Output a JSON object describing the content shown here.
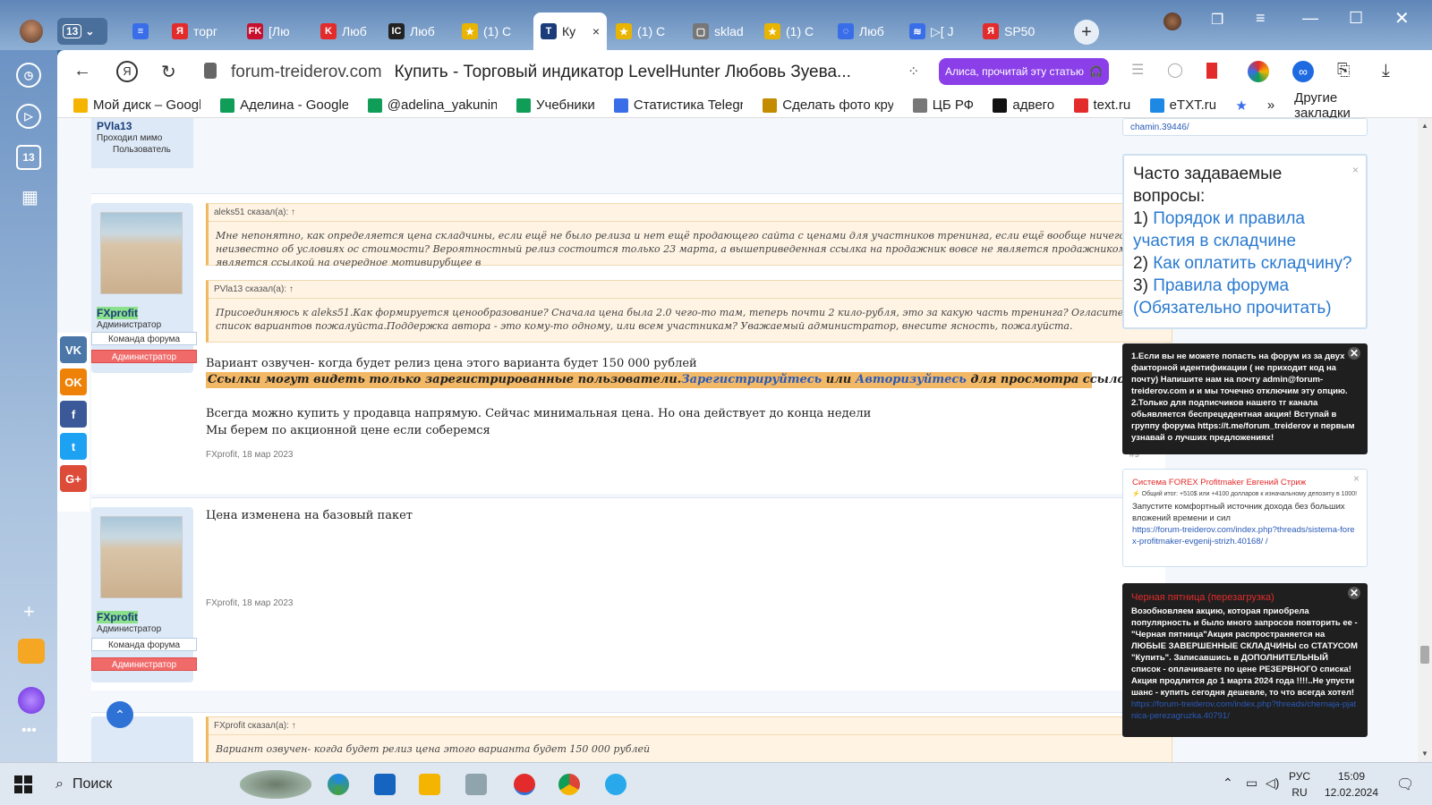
{
  "tabs": {
    "count": "13",
    "items": [
      {
        "label": "",
        "fav": "doc-icon",
        "color": "#3a6ee8"
      },
      {
        "label": "торг",
        "fav": "Я",
        "color": "#e32b2b"
      },
      {
        "label": "[Лю",
        "fav": "FK",
        "color": "#c8102e"
      },
      {
        "label": "Люб",
        "fav": "K",
        "color": "#e32b2b"
      },
      {
        "label": "Люб",
        "fav": "IC",
        "color": "#222"
      },
      {
        "label": "(1) С",
        "fav": "★",
        "color": "#e8b400"
      },
      {
        "label": "Ку",
        "fav": "T",
        "color": "#1a3c7a",
        "active": true
      },
      {
        "label": "(1) С",
        "fav": "★",
        "color": "#e8b400"
      },
      {
        "label": "sklad",
        "fav": "▢",
        "color": "#777"
      },
      {
        "label": "(1) С",
        "fav": "★",
        "color": "#e8b400"
      },
      {
        "label": "Люб",
        "fav": "◌",
        "color": "#3a6ee8"
      },
      {
        "label": "▷[ J",
        "fav": "≋",
        "color": "#3a6ee8"
      },
      {
        "label": "SP50",
        "fav": "Я",
        "color": "#e32b2b"
      }
    ],
    "close": "×",
    "new": "+"
  },
  "toolbar": {
    "url": "forum-treiderov.com",
    "title": "Купить - Торговый индикатор LevelHunter Любовь Зуева...",
    "alice": "Алиса, прочитай эту статью"
  },
  "bookmarks": [
    {
      "label": "Мой диск – Googl",
      "color": "#f4b400"
    },
    {
      "label": "Аделина - Google",
      "color": "#0f9d58"
    },
    {
      "label": "@adelina_yakunin",
      "color": "#0f9d58"
    },
    {
      "label": "Учебники",
      "color": "#0f9d58"
    },
    {
      "label": "Статистика Telegr",
      "color": "#3a6ee8"
    },
    {
      "label": "Сделать фото кру",
      "color": "#c48a00"
    },
    {
      "label": "ЦБ РФ",
      "color": "#777"
    },
    {
      "label": "адвего",
      "color": "#111"
    },
    {
      "label": "text.ru",
      "color": "#e32b2b"
    },
    {
      "label": "eTXT.ru",
      "color": "#1e88e5"
    }
  ],
  "bookmarks_more": "»",
  "bookmarks_other": "Другие закладки",
  "sidebar": {
    "badge": "13"
  },
  "social": [
    "VK",
    "OK",
    "f",
    "t",
    "G+"
  ],
  "posts": {
    "top_user": {
      "name": "PVla13",
      "role": "Проходил мимо",
      "badge": "Пользователь"
    },
    "p1": {
      "user": {
        "name": "FXprofit",
        "role": "Администратор",
        "team": "Команда форума",
        "admin": "Администратор"
      },
      "quote1_head": "aleks51 сказал(а): ↑",
      "quote1_body": "Мне непонятно, как определяется цена складчины, если ещё не было релиза и нет ещё продающего сайта с ценами для участников тренинга, если ещё вообще ничего неизвестно об условиях ос стоимости? Вероятностный релиз состоится только 23 марта, а вышеприведенная ссылка на продажник вовсе не является продажником, а является ссылкой на очередное мотивирубщее в",
      "quote2_head": "PVla13 сказал(а): ↑",
      "quote2_body": "Присоединяюсь к aleks51.Как формируется ценообразование? Сначала цена была 2.0 чего-то там, теперь почти 2 кило-рубля, это за какую часть тренинга? Огласите весь список вариантов пожалуйста.Поддержка автора - это кому-то одному, или всем участникам? Уважаемый администратор, внесите ясность, пожалуйста.",
      "line1": "Вариант озвучен- когда будет релиз цена этого варианта будет 150 000 рублей",
      "warn_a": "Ссылки могут видеть только зарегистрированные пользователи.",
      "warn_link1": "Зарегистрируйтесь",
      "warn_or": " или ",
      "warn_link2": "Авторизуйтесь",
      "warn_b": " для просмотра ссылок",
      "line2": "Всегда можно купить у продавца напрямую. Сейчас минимальная цена. Но она действует до конца недели",
      "line3": "Мы берем по акционной цене если соберемся",
      "meta": "FXprofit, 18 мар 2023",
      "num": "#9"
    },
    "p2": {
      "user": {
        "name": "FXprofit",
        "role": "Администратор",
        "team": "Команда форума",
        "admin": "Администратор"
      },
      "line1": "Цена изменена на базовый пакет",
      "meta": "FXprofit, 18 мар 2023"
    },
    "p3": {
      "quote_head": "FXprofit сказал(а): ↑",
      "quote_body": "Вариант озвучен- когда будет релиз цена этого варианта будет 150 000 рублей"
    }
  },
  "widgets": {
    "top_link": "chamin.39446/",
    "faq_title": "Часто задаваемые вопросы:",
    "faq_items": [
      {
        "num": "1) ",
        "label": "Порядок и правила участия в складчине"
      },
      {
        "num": "2) ",
        "label": "Как оплатить складчину?"
      },
      {
        "num": "3) ",
        "label": "Правила форума (Обязательно прочитать)"
      }
    ],
    "notice": "1.Если вы не можете попасть на форум из за двух факторной идентификации ( не приходит код на почту) Напишите нам на почту admin@forum-treiderov.com и и мы точечно отключим эту опцию. 2.Только для подписчиков нашего тг канала обьявляется беспрецедентная акция! Вступай в группу форума https://t.me/forum_treiderov и первым узнавай о лучших предложениях!",
    "forex_title": "Система FOREX Profitmaker Евгений Стриж",
    "forex_sub": "⚡ Общий итог: +510$ или +4100 долларов к изначальному депозиту в 1000!",
    "forex_text": "Запустите комфортный источник дохода без больших вложений времени и сил",
    "forex_link": "https://forum-treiderov.com/index.php?threads/sistema-forex-profitmaker-evgenij-strizh.40168/ /",
    "bf_title": "Черная пятница (перезагрузка)",
    "bf_text": "Возобновляем акцию, которая приобрела популярность и было много запросов повторить ее - \"Черная пятница\"Акция распространяется на ЛЮБЫЕ ЗАВЕРШЕННЫЕ СКЛАДЧИНЫ со СТАТУСОМ \"Купить\". Записавшись в ДОПОЛНИТЕЛЬНЫЙ список - оплачиваете по цене РЕЗЕРВНОГО списка! Акция продлится до 1 марта 2024 года !!!!..Не упусти шанс - купить сегодня дешевле, то что всегда хотел!",
    "bf_link": "https://forum-treiderov.com/index.php?threads/chernaja-pjatnica-perezagruzka.40791/"
  },
  "taskbar": {
    "search": "Поиск",
    "lang1": "РУС",
    "lang2": "RU",
    "time": "15:09",
    "date": "12.02.2024"
  }
}
